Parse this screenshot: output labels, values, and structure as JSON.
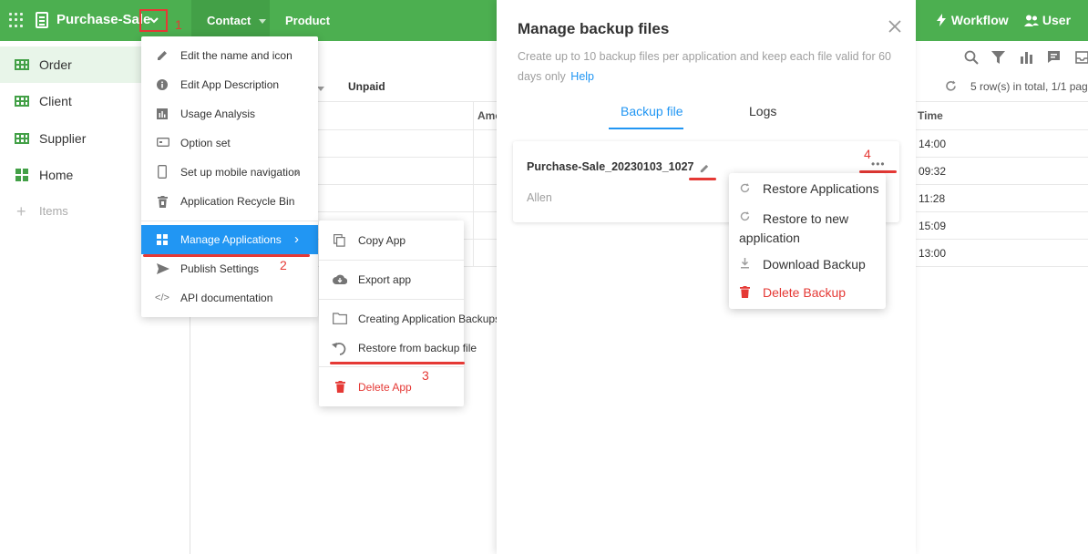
{
  "topbar": {
    "app_title": "Purchase-Sale",
    "chevron": "⌄",
    "nav": [
      {
        "label": "Contact"
      },
      {
        "label": "Product"
      }
    ],
    "right": [
      {
        "label": "Workflow",
        "icon": "bolt-icon"
      },
      {
        "label": "User",
        "icon": "users-icon"
      }
    ],
    "accent_color": "#4caf50"
  },
  "annotations": [
    "1",
    "2",
    "3",
    "4"
  ],
  "sidebar": {
    "items": [
      {
        "label": "Order",
        "icon": "table-icon",
        "active": true
      },
      {
        "label": "Client",
        "icon": "table-icon"
      },
      {
        "label": "Supplier",
        "icon": "table-icon"
      },
      {
        "label": "Home",
        "icon": "dashboard-icon"
      },
      {
        "label": "Items",
        "icon": "plus-icon"
      }
    ]
  },
  "main": {
    "filter_tab": "Unpaid",
    "column_partial": "Amo",
    "row_count_text": "5 row(s) in total, 1/1 pag",
    "time_header": "Time",
    "times": [
      "14:00",
      "09:32",
      "11:28",
      "15:09",
      "13:00"
    ]
  },
  "app_menu": {
    "items": [
      {
        "label": "Edit the name and icon",
        "icon": "pencil-icon"
      },
      {
        "label": "Edit App Description",
        "icon": "info-icon"
      },
      {
        "label": "Usage Analysis",
        "icon": "bar-chart-icon"
      },
      {
        "label": "Option set",
        "icon": "option-icon"
      },
      {
        "label": "Set up mobile navigation",
        "icon": "mobile-icon"
      },
      {
        "label": "Application Recycle Bin",
        "icon": "recycle-bin-icon"
      },
      {
        "label": "Manage Applications",
        "icon": "apps-icon",
        "highlighted": true
      },
      {
        "label": "Publish Settings",
        "icon": "send-icon"
      },
      {
        "label": "API documentation",
        "icon": "code-icon"
      }
    ]
  },
  "submenu": {
    "items": [
      {
        "label": "Copy App",
        "icon": "copy-icon"
      },
      {
        "label": "Export app",
        "icon": "cloud-download-icon"
      },
      {
        "label": "Creating Application Backups",
        "icon": "folder-icon"
      },
      {
        "label": "Restore from backup file",
        "icon": "undo-icon"
      },
      {
        "label": "Delete App",
        "icon": "trash-icon",
        "danger": true
      }
    ],
    "danger_color": "#e53935"
  },
  "dialog": {
    "title": "Manage backup files",
    "description": "Create up to 10 backup files per application and keep each file valid for 60 days only",
    "help_link": "Help",
    "tabs": [
      {
        "label": "Backup file",
        "active": true
      },
      {
        "label": "Logs"
      }
    ],
    "backup": {
      "name": "Purchase-Sale_20230103_1027",
      "author": "Allen"
    },
    "link_color": "#2196f3"
  },
  "backup_menu": {
    "items": [
      {
        "label": "Restore Applications",
        "icon": "restore-icon"
      },
      {
        "label": "Restore to new application",
        "icon": "restore-icon"
      },
      {
        "label": "Download Backup",
        "icon": "download-icon"
      },
      {
        "label": "Delete Backup",
        "icon": "trash-icon",
        "danger": true
      }
    ]
  }
}
